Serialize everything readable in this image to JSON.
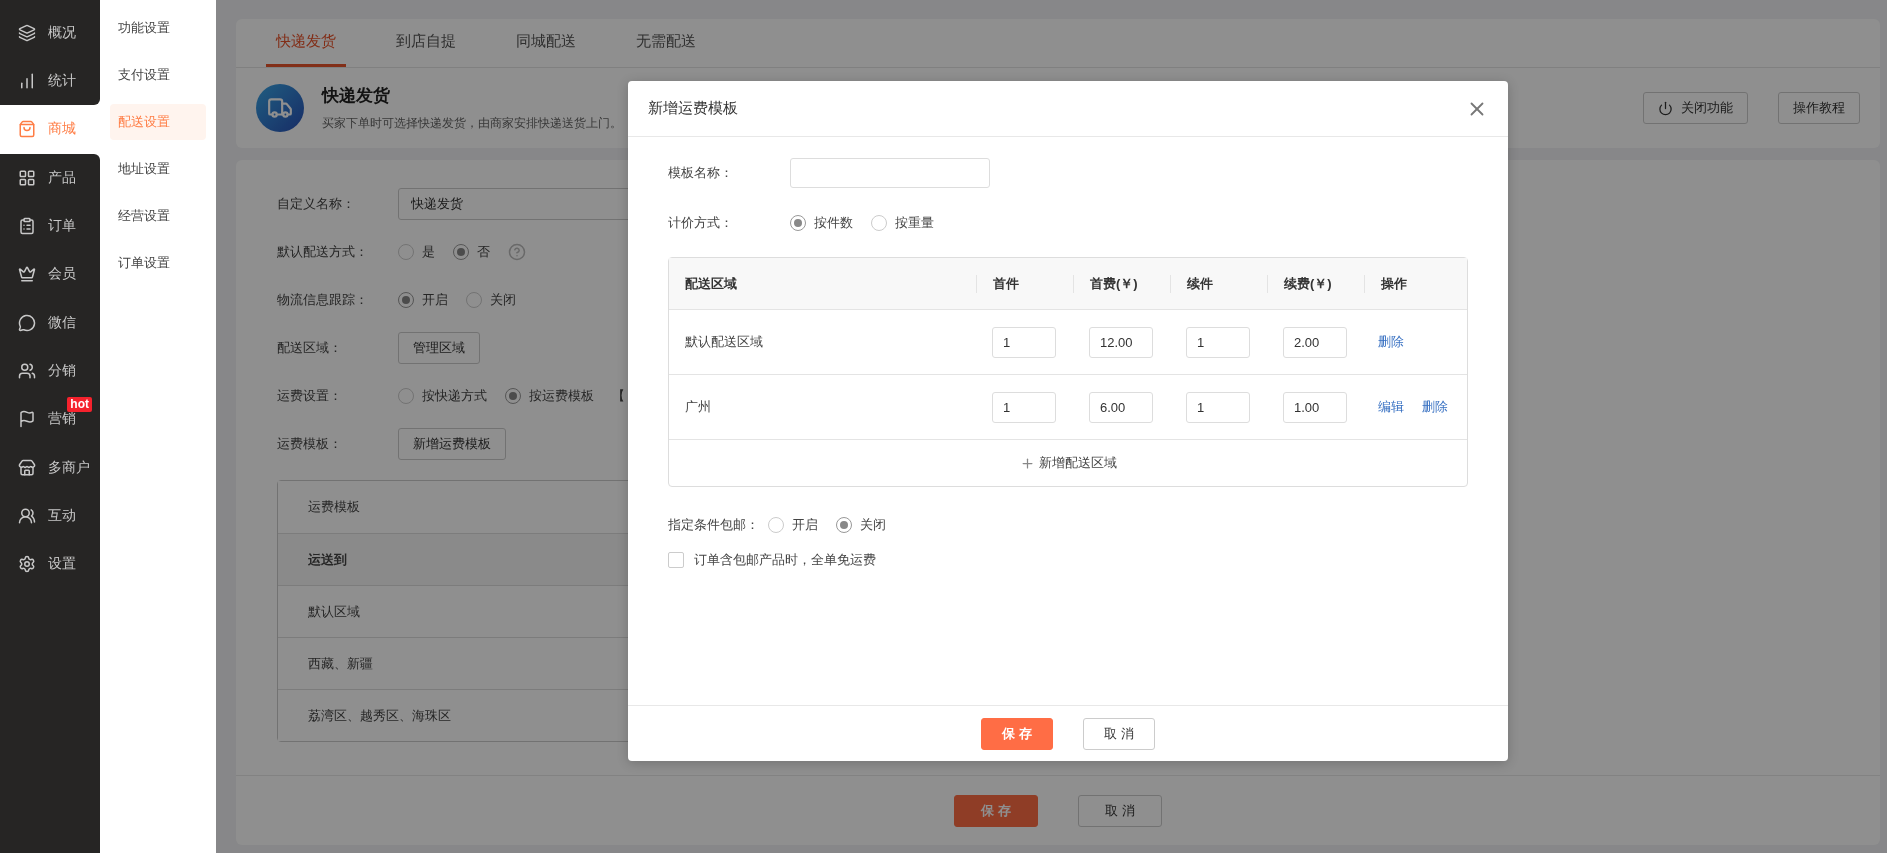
{
  "sidebar": {
    "items": [
      {
        "label": "概况",
        "selected": false
      },
      {
        "label": "统计",
        "selected": false
      },
      {
        "label": "商城",
        "selected": true
      },
      {
        "label": "产品",
        "selected": false
      },
      {
        "label": "订单",
        "selected": false
      },
      {
        "label": "会员",
        "selected": false
      },
      {
        "label": "微信",
        "selected": false
      },
      {
        "label": "分销",
        "selected": false
      },
      {
        "label": "营销",
        "selected": false,
        "badge": "hot"
      },
      {
        "label": "多商户",
        "selected": false
      },
      {
        "label": "互动",
        "selected": false
      },
      {
        "label": "设置",
        "selected": false
      }
    ]
  },
  "submenu": {
    "items": [
      {
        "label": "功能设置",
        "selected": false
      },
      {
        "label": "支付设置",
        "selected": false
      },
      {
        "label": "配送设置",
        "selected": true
      },
      {
        "label": "地址设置",
        "selected": false
      },
      {
        "label": "经营设置",
        "selected": false
      },
      {
        "label": "订单设置",
        "selected": false
      }
    ]
  },
  "tabs": [
    {
      "label": "快递发货",
      "selected": true
    },
    {
      "label": "到店自提",
      "selected": false
    },
    {
      "label": "同城配送",
      "selected": false
    },
    {
      "label": "无需配送",
      "selected": false
    }
  ],
  "header": {
    "title": "快递发货",
    "description": "买家下单时可选择快递发货，由商家安排快递送货上门。",
    "buttons": [
      {
        "label": "关闭功能",
        "kind": "power"
      },
      {
        "label": "操作教程",
        "kind": "plain"
      }
    ]
  },
  "form": {
    "rows": [
      {
        "kind": "input",
        "label": "自定义名称：",
        "value": "快递发货"
      },
      {
        "kind": "radio",
        "label": "默认配送方式：",
        "help": true,
        "options": [
          {
            "label": "是",
            "selected": false
          },
          {
            "label": "否",
            "selected": true
          }
        ]
      },
      {
        "kind": "radio",
        "label": "物流信息跟踪：",
        "options": [
          {
            "label": "开启",
            "selected": true
          },
          {
            "label": "关闭",
            "selected": false
          }
        ]
      },
      {
        "kind": "button",
        "label": "配送区域：",
        "button": "管理区域"
      },
      {
        "kind": "radio",
        "label": "运费设置：",
        "options": [
          {
            "label": "按快递方式",
            "selected": false
          },
          {
            "label": "按运费模板",
            "selected": true
          }
        ],
        "suffix": "【"
      },
      {
        "kind": "button",
        "label": "运费模板：",
        "button": "新增运费模板"
      }
    ],
    "templates": [
      {
        "rows": [
          {
            "kind": "title",
            "text": "运费模板"
          },
          {
            "kind": "head",
            "text": "运送到"
          },
          {
            "kind": "cell",
            "text": "默认区域"
          },
          {
            "kind": "cell",
            "text": "西藏、新疆"
          },
          {
            "kind": "cell",
            "text": "荔湾区、越秀区、海珠区"
          }
        ]
      }
    ]
  },
  "footer": {
    "buttons": [
      {
        "label": "保 存",
        "kind": "primary"
      },
      {
        "label": "取 消",
        "kind": "default"
      }
    ]
  },
  "modal": {
    "title": "新增运费模板",
    "name_field": {
      "label": "模板名称："
    },
    "pricing": {
      "label": "计价方式：",
      "options": [
        {
          "label": "按件数",
          "selected": true
        },
        {
          "label": "按重量",
          "selected": false
        }
      ]
    },
    "table": {
      "columns": [
        "配送区域",
        "首件",
        "首费(￥)",
        "续件",
        "续费(￥)",
        "操作"
      ],
      "rows": [
        {
          "region": "默认配送区域",
          "values": [
            "1",
            "12.00",
            "1",
            "2.00"
          ],
          "actions": [
            "删除"
          ]
        },
        {
          "region": "广州",
          "values": [
            "1",
            "6.00",
            "1",
            "1.00"
          ],
          "actions": [
            "编辑",
            "删除"
          ]
        }
      ],
      "add": "新增配送区域"
    },
    "free_shipping": {
      "label": "指定条件包邮：",
      "options": [
        {
          "label": "开启",
          "selected": false
        },
        {
          "label": "关闭",
          "selected": true
        }
      ]
    },
    "checkbox": {
      "label": "订单含包邮产品时，全单免运费",
      "checked": false
    },
    "buttons": [
      {
        "label": "保 存",
        "kind": "primary"
      },
      {
        "label": "取 消",
        "kind": "default"
      }
    ]
  }
}
